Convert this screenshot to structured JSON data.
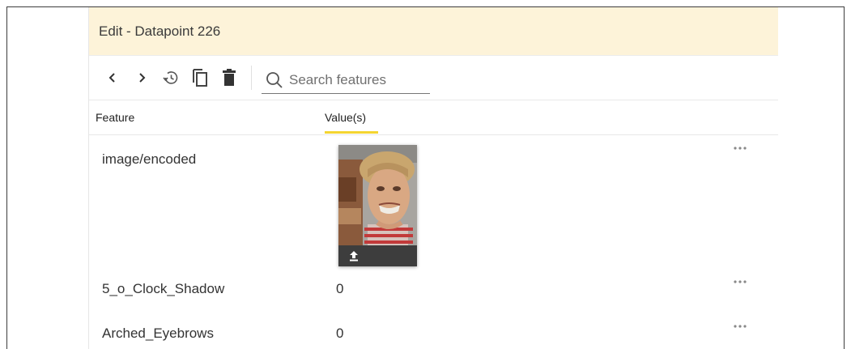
{
  "header": {
    "title": "Edit - Datapoint 226",
    "background": "#fdf3d9"
  },
  "toolbar": {
    "icons": [
      "chevron-left-icon",
      "chevron-right-icon",
      "history-icon",
      "copy-icon",
      "delete-icon"
    ],
    "search_placeholder": "Search features",
    "search_value": ""
  },
  "columns": {
    "feature": "Feature",
    "values": "Value(s)",
    "active_underline_color": "#f4d531"
  },
  "rows": [
    {
      "feature": "image/encoded",
      "value": "",
      "value_type": "image",
      "more_icon": "more-horizontal-icon"
    },
    {
      "feature": "5_o_Clock_Shadow",
      "value": "0",
      "more_icon": "more-horizontal-icon"
    },
    {
      "feature": "Arched_Eyebrows",
      "value": "0",
      "more_icon": "more-horizontal-icon"
    }
  ]
}
